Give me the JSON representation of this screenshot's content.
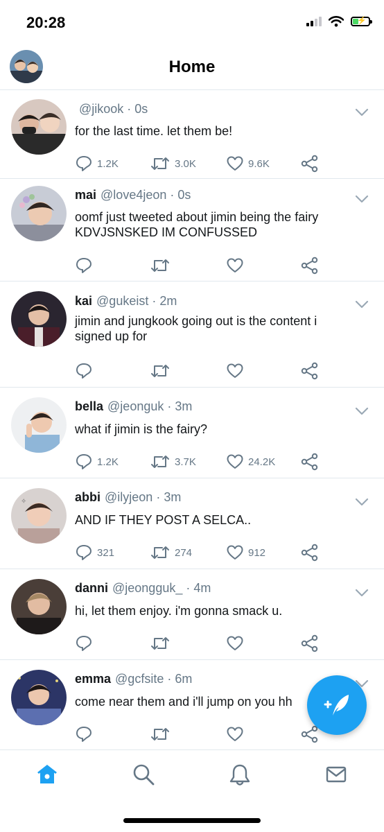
{
  "status_bar": {
    "time": "20:28",
    "signal_icon": "cellular-signal-icon",
    "wifi_icon": "wifi-icon",
    "battery_icon": "battery-charging-icon",
    "battery_level": 0.35
  },
  "header": {
    "title": "Home",
    "avatar_icon": "profile-avatar"
  },
  "tweets": [
    {
      "name": "",
      "handle": "@jikook",
      "time": "0s",
      "text": "for the last time. let them be!",
      "replies": "1.2K",
      "retweets": "3.0K",
      "likes": "9.6K"
    },
    {
      "name": "mai",
      "handle": "@love4jeon",
      "time": "0s",
      "text": "oomf just tweeted about jimin being the fairy KDVJSNSKED IM CONFUSSED",
      "replies": "",
      "retweets": "",
      "likes": ""
    },
    {
      "name": "kai",
      "handle": "@gukeist",
      "time": "2m",
      "text": "jimin and jungkook going out is the content i signed up for",
      "replies": "",
      "retweets": "",
      "likes": ""
    },
    {
      "name": "bella",
      "handle": "@jeonguk",
      "time": "3m",
      "text": "what if jimin is the fairy?",
      "replies": "1.2K",
      "retweets": "3.7K",
      "likes": "24.2K"
    },
    {
      "name": "abbi",
      "handle": "@ilyjeon",
      "time": "3m",
      "text": "AND IF THEY POST A SELCA..",
      "replies": "321",
      "retweets": "274",
      "likes": "912"
    },
    {
      "name": "danni",
      "handle": "@jeongguk_",
      "time": "4m",
      "text": "hi, let them enjoy. i'm gonna smack u.",
      "replies": "",
      "retweets": "",
      "likes": ""
    },
    {
      "name": "emma",
      "handle": "@gcfsite",
      "time": "6m",
      "text": "come near them and i'll jump on you hh",
      "replies": "",
      "retweets": "",
      "likes": ""
    }
  ],
  "tweet_icons": {
    "reply": "reply-icon",
    "retweet": "retweet-icon",
    "like": "heart-icon",
    "share": "share-icon",
    "more": "chevron-down-icon"
  },
  "fab": {
    "icon": "compose-tweet-icon"
  },
  "bottom_nav": [
    {
      "icon": "home-icon",
      "active": true
    },
    {
      "icon": "search-icon",
      "active": false
    },
    {
      "icon": "notifications-bell-icon",
      "active": false
    },
    {
      "icon": "messages-envelope-icon",
      "active": false
    }
  ],
  "colors": {
    "accent": "#1da1f2",
    "text": "#14171a",
    "muted": "#657786",
    "divider": "#e1e8ed"
  }
}
